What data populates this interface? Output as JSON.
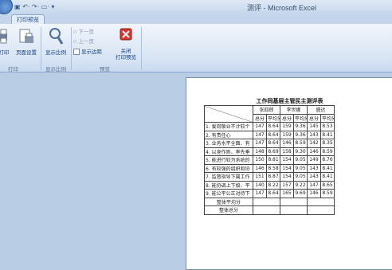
{
  "window": {
    "title": "测评 - Microsoft Excel"
  },
  "ribbon": {
    "tab": "打印预览",
    "buttons": {
      "print": "打印",
      "page_setup": "页面设置",
      "zoom": "显示比例",
      "next_page": "下一页",
      "prev_page": "上一页",
      "show_margins": "显示边距",
      "close_preview_line1": "关闭",
      "close_preview_line2": "打印预览"
    },
    "groups": {
      "print": "打印",
      "zoom": "显示比例",
      "preview": "预览"
    }
  },
  "sheet": {
    "title": "工作同基层主管民主测评表",
    "people": [
      "张四郎",
      "李世娜",
      "盛达"
    ],
    "sub_headers": [
      "总分",
      "平均分"
    ],
    "rows": [
      {
        "item": "1. 爱岗敬业不计较个",
        "values": [
          "147",
          "8.64",
          "159",
          "9.36",
          "145",
          "8.53"
        ]
      },
      {
        "item": "2. 有责任心",
        "values": [
          "147",
          "8.64",
          "159",
          "9.36",
          "143",
          "8.41"
        ]
      },
      {
        "item": "3. 业务水平全面、有",
        "values": [
          "147",
          "8.64",
          "146",
          "8.59",
          "142",
          "8.35"
        ]
      },
      {
        "item": "4. 以身作则、率先垂",
        "values": [
          "148",
          "8.69",
          "158",
          "9.30",
          "146",
          "8.59"
        ]
      },
      {
        "item": "5. 能进行较为系统的",
        "values": [
          "150",
          "8.81",
          "154",
          "9.05",
          "149",
          "8.76"
        ]
      },
      {
        "item": "6. 有较强的组织和协",
        "values": [
          "146",
          "8.58",
          "154",
          "9.05",
          "143",
          "8.41"
        ]
      },
      {
        "item": "7. 监督指导下属工作",
        "values": [
          "151",
          "8.87",
          "154",
          "9.05",
          "143",
          "8.41"
        ]
      },
      {
        "item": "8. 能协调上下级、平",
        "values": [
          "140",
          "8.22",
          "157",
          "9.22",
          "147",
          "8.65"
        ]
      },
      {
        "item": "9. 能公平公正对待下",
        "values": [
          "147",
          "8.64",
          "165",
          "9.69",
          "146",
          "8.59"
        ]
      }
    ],
    "summary": [
      {
        "label": "整体平均分"
      },
      {
        "label": "整体总分"
      }
    ]
  }
}
